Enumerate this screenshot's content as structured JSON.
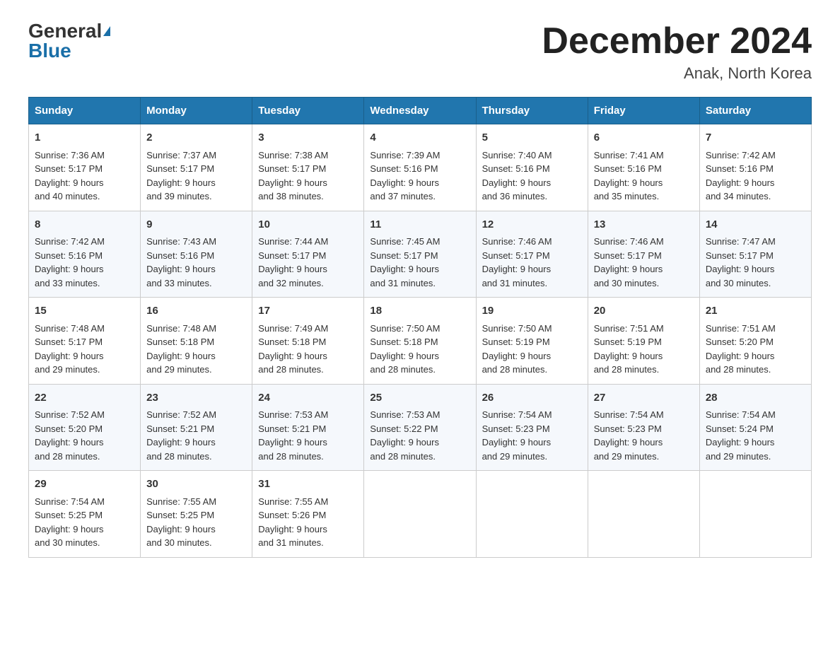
{
  "logo": {
    "general": "General",
    "blue": "Blue"
  },
  "title": "December 2024",
  "location": "Anak, North Korea",
  "days_of_week": [
    "Sunday",
    "Monday",
    "Tuesday",
    "Wednesday",
    "Thursday",
    "Friday",
    "Saturday"
  ],
  "weeks": [
    [
      {
        "day": "1",
        "sunrise": "7:36 AM",
        "sunset": "5:17 PM",
        "daylight": "9 hours and 40 minutes."
      },
      {
        "day": "2",
        "sunrise": "7:37 AM",
        "sunset": "5:17 PM",
        "daylight": "9 hours and 39 minutes."
      },
      {
        "day": "3",
        "sunrise": "7:38 AM",
        "sunset": "5:17 PM",
        "daylight": "9 hours and 38 minutes."
      },
      {
        "day": "4",
        "sunrise": "7:39 AM",
        "sunset": "5:16 PM",
        "daylight": "9 hours and 37 minutes."
      },
      {
        "day": "5",
        "sunrise": "7:40 AM",
        "sunset": "5:16 PM",
        "daylight": "9 hours and 36 minutes."
      },
      {
        "day": "6",
        "sunrise": "7:41 AM",
        "sunset": "5:16 PM",
        "daylight": "9 hours and 35 minutes."
      },
      {
        "day": "7",
        "sunrise": "7:42 AM",
        "sunset": "5:16 PM",
        "daylight": "9 hours and 34 minutes."
      }
    ],
    [
      {
        "day": "8",
        "sunrise": "7:42 AM",
        "sunset": "5:16 PM",
        "daylight": "9 hours and 33 minutes."
      },
      {
        "day": "9",
        "sunrise": "7:43 AM",
        "sunset": "5:16 PM",
        "daylight": "9 hours and 33 minutes."
      },
      {
        "day": "10",
        "sunrise": "7:44 AM",
        "sunset": "5:17 PM",
        "daylight": "9 hours and 32 minutes."
      },
      {
        "day": "11",
        "sunrise": "7:45 AM",
        "sunset": "5:17 PM",
        "daylight": "9 hours and 31 minutes."
      },
      {
        "day": "12",
        "sunrise": "7:46 AM",
        "sunset": "5:17 PM",
        "daylight": "9 hours and 31 minutes."
      },
      {
        "day": "13",
        "sunrise": "7:46 AM",
        "sunset": "5:17 PM",
        "daylight": "9 hours and 30 minutes."
      },
      {
        "day": "14",
        "sunrise": "7:47 AM",
        "sunset": "5:17 PM",
        "daylight": "9 hours and 30 minutes."
      }
    ],
    [
      {
        "day": "15",
        "sunrise": "7:48 AM",
        "sunset": "5:17 PM",
        "daylight": "9 hours and 29 minutes."
      },
      {
        "day": "16",
        "sunrise": "7:48 AM",
        "sunset": "5:18 PM",
        "daylight": "9 hours and 29 minutes."
      },
      {
        "day": "17",
        "sunrise": "7:49 AM",
        "sunset": "5:18 PM",
        "daylight": "9 hours and 28 minutes."
      },
      {
        "day": "18",
        "sunrise": "7:50 AM",
        "sunset": "5:18 PM",
        "daylight": "9 hours and 28 minutes."
      },
      {
        "day": "19",
        "sunrise": "7:50 AM",
        "sunset": "5:19 PM",
        "daylight": "9 hours and 28 minutes."
      },
      {
        "day": "20",
        "sunrise": "7:51 AM",
        "sunset": "5:19 PM",
        "daylight": "9 hours and 28 minutes."
      },
      {
        "day": "21",
        "sunrise": "7:51 AM",
        "sunset": "5:20 PM",
        "daylight": "9 hours and 28 minutes."
      }
    ],
    [
      {
        "day": "22",
        "sunrise": "7:52 AM",
        "sunset": "5:20 PM",
        "daylight": "9 hours and 28 minutes."
      },
      {
        "day": "23",
        "sunrise": "7:52 AM",
        "sunset": "5:21 PM",
        "daylight": "9 hours and 28 minutes."
      },
      {
        "day": "24",
        "sunrise": "7:53 AM",
        "sunset": "5:21 PM",
        "daylight": "9 hours and 28 minutes."
      },
      {
        "day": "25",
        "sunrise": "7:53 AM",
        "sunset": "5:22 PM",
        "daylight": "9 hours and 28 minutes."
      },
      {
        "day": "26",
        "sunrise": "7:54 AM",
        "sunset": "5:23 PM",
        "daylight": "9 hours and 29 minutes."
      },
      {
        "day": "27",
        "sunrise": "7:54 AM",
        "sunset": "5:23 PM",
        "daylight": "9 hours and 29 minutes."
      },
      {
        "day": "28",
        "sunrise": "7:54 AM",
        "sunset": "5:24 PM",
        "daylight": "9 hours and 29 minutes."
      }
    ],
    [
      {
        "day": "29",
        "sunrise": "7:54 AM",
        "sunset": "5:25 PM",
        "daylight": "9 hours and 30 minutes."
      },
      {
        "day": "30",
        "sunrise": "7:55 AM",
        "sunset": "5:25 PM",
        "daylight": "9 hours and 30 minutes."
      },
      {
        "day": "31",
        "sunrise": "7:55 AM",
        "sunset": "5:26 PM",
        "daylight": "9 hours and 31 minutes."
      },
      null,
      null,
      null,
      null
    ]
  ]
}
